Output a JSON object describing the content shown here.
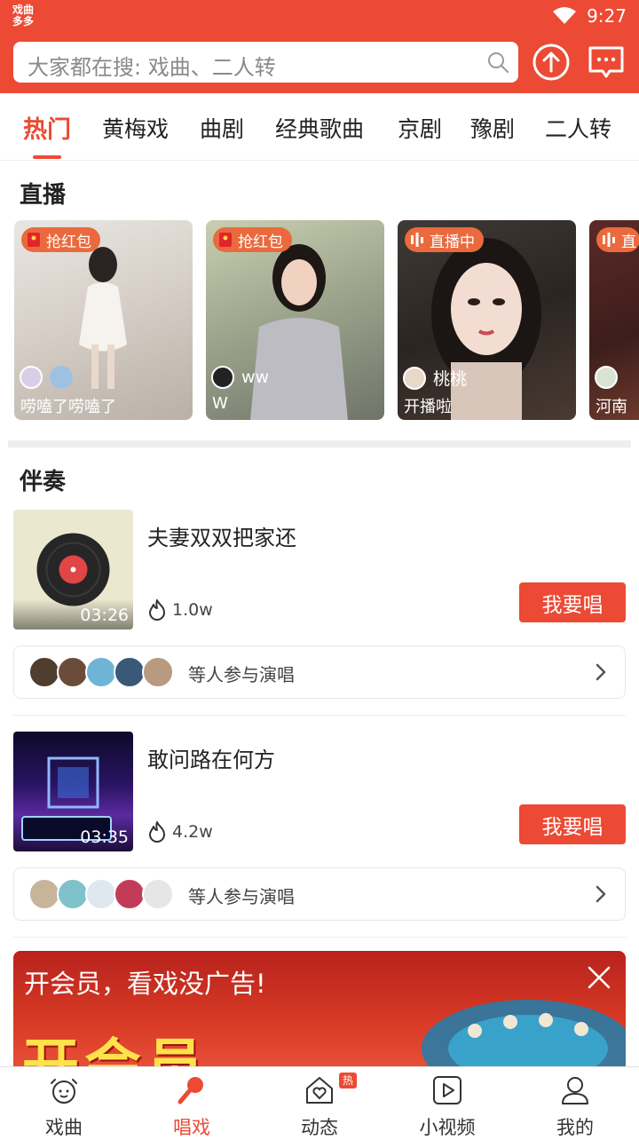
{
  "status_bar": {
    "app_logo_text": "戏曲多多",
    "time": "9:27",
    "icons": [
      "wifi-icon",
      "battery-icon"
    ]
  },
  "search": {
    "placeholder": "大家都在搜: 戏曲、二人转"
  },
  "header_actions": [
    "upload-icon",
    "message-icon"
  ],
  "tabs": [
    {
      "label": "热门",
      "active": true
    },
    {
      "label": "黄梅戏"
    },
    {
      "label": "曲剧"
    },
    {
      "label": "经典歌曲"
    },
    {
      "label": "京剧"
    },
    {
      "label": "豫剧"
    },
    {
      "label": "二人转"
    }
  ],
  "live": {
    "title": "直播",
    "cards": [
      {
        "badge": "抢红包",
        "host": "",
        "caption": "唠嗑了唠嗑了"
      },
      {
        "badge": "抢红包",
        "host": "ww",
        "caption": "W"
      },
      {
        "badge": "直播中",
        "host": "桃桃",
        "caption": "开播啦"
      },
      {
        "badge": "直",
        "host": "",
        "caption": "河南"
      }
    ]
  },
  "accompaniment": {
    "title": "伴奏",
    "songs": [
      {
        "title": "夫妻双双把家还",
        "duration": "03:26",
        "heat": "1.0w",
        "sing_label": "我要唱",
        "participants_text": "等人参与演唱"
      },
      {
        "title": "敢问路在何方",
        "duration": "03:35",
        "heat": "4.2w",
        "sing_label": "我要唱",
        "participants_text": "等人参与演唱"
      }
    ]
  },
  "banner": {
    "text": "开会员，看戏没广告!",
    "big_text": "开会员"
  },
  "bottom_nav": [
    {
      "label": "戏曲",
      "icon": "alarm-clock-icon",
      "active": false
    },
    {
      "label": "唱戏",
      "icon": "microphone-icon",
      "active": true
    },
    {
      "label": "动态",
      "icon": "home-heart-icon",
      "active": false,
      "badge": "热"
    },
    {
      "label": "小视频",
      "icon": "play-video-icon",
      "active": false
    },
    {
      "label": "我的",
      "icon": "person-icon",
      "active": false
    }
  ],
  "colors": {
    "brand": "#ec4a34",
    "badge_orange": "#ea6a3e"
  }
}
